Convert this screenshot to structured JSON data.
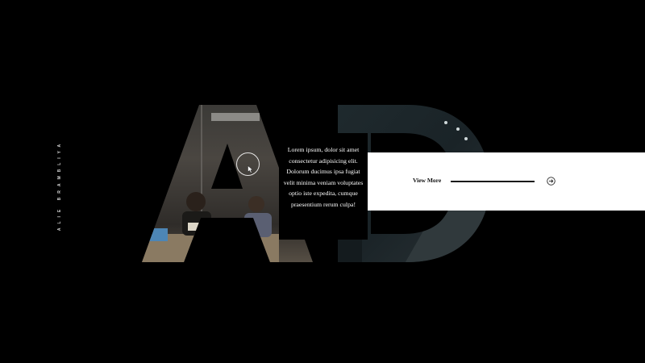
{
  "brand": {
    "vertical_name": "ALIE BRAMBLIYA"
  },
  "hero": {
    "letters": "AD",
    "background": "office meeting photo",
    "body_text": "Lorem ipsum, dolor sit amet consectetur adipisicing elit. Dolorum ducimus ipsa fugiat velit minima veniam voluptates optio iste expedita, cumque praesentium rerum culpa!"
  },
  "cta": {
    "label": "View More",
    "icon": "arrow-right-circle-icon"
  },
  "cursor": {
    "icon": "pointer-cursor-icon"
  },
  "colors": {
    "background": "#000000",
    "band": "#ffffff",
    "text_light": "#ffffff",
    "text_dark": "#111111"
  }
}
